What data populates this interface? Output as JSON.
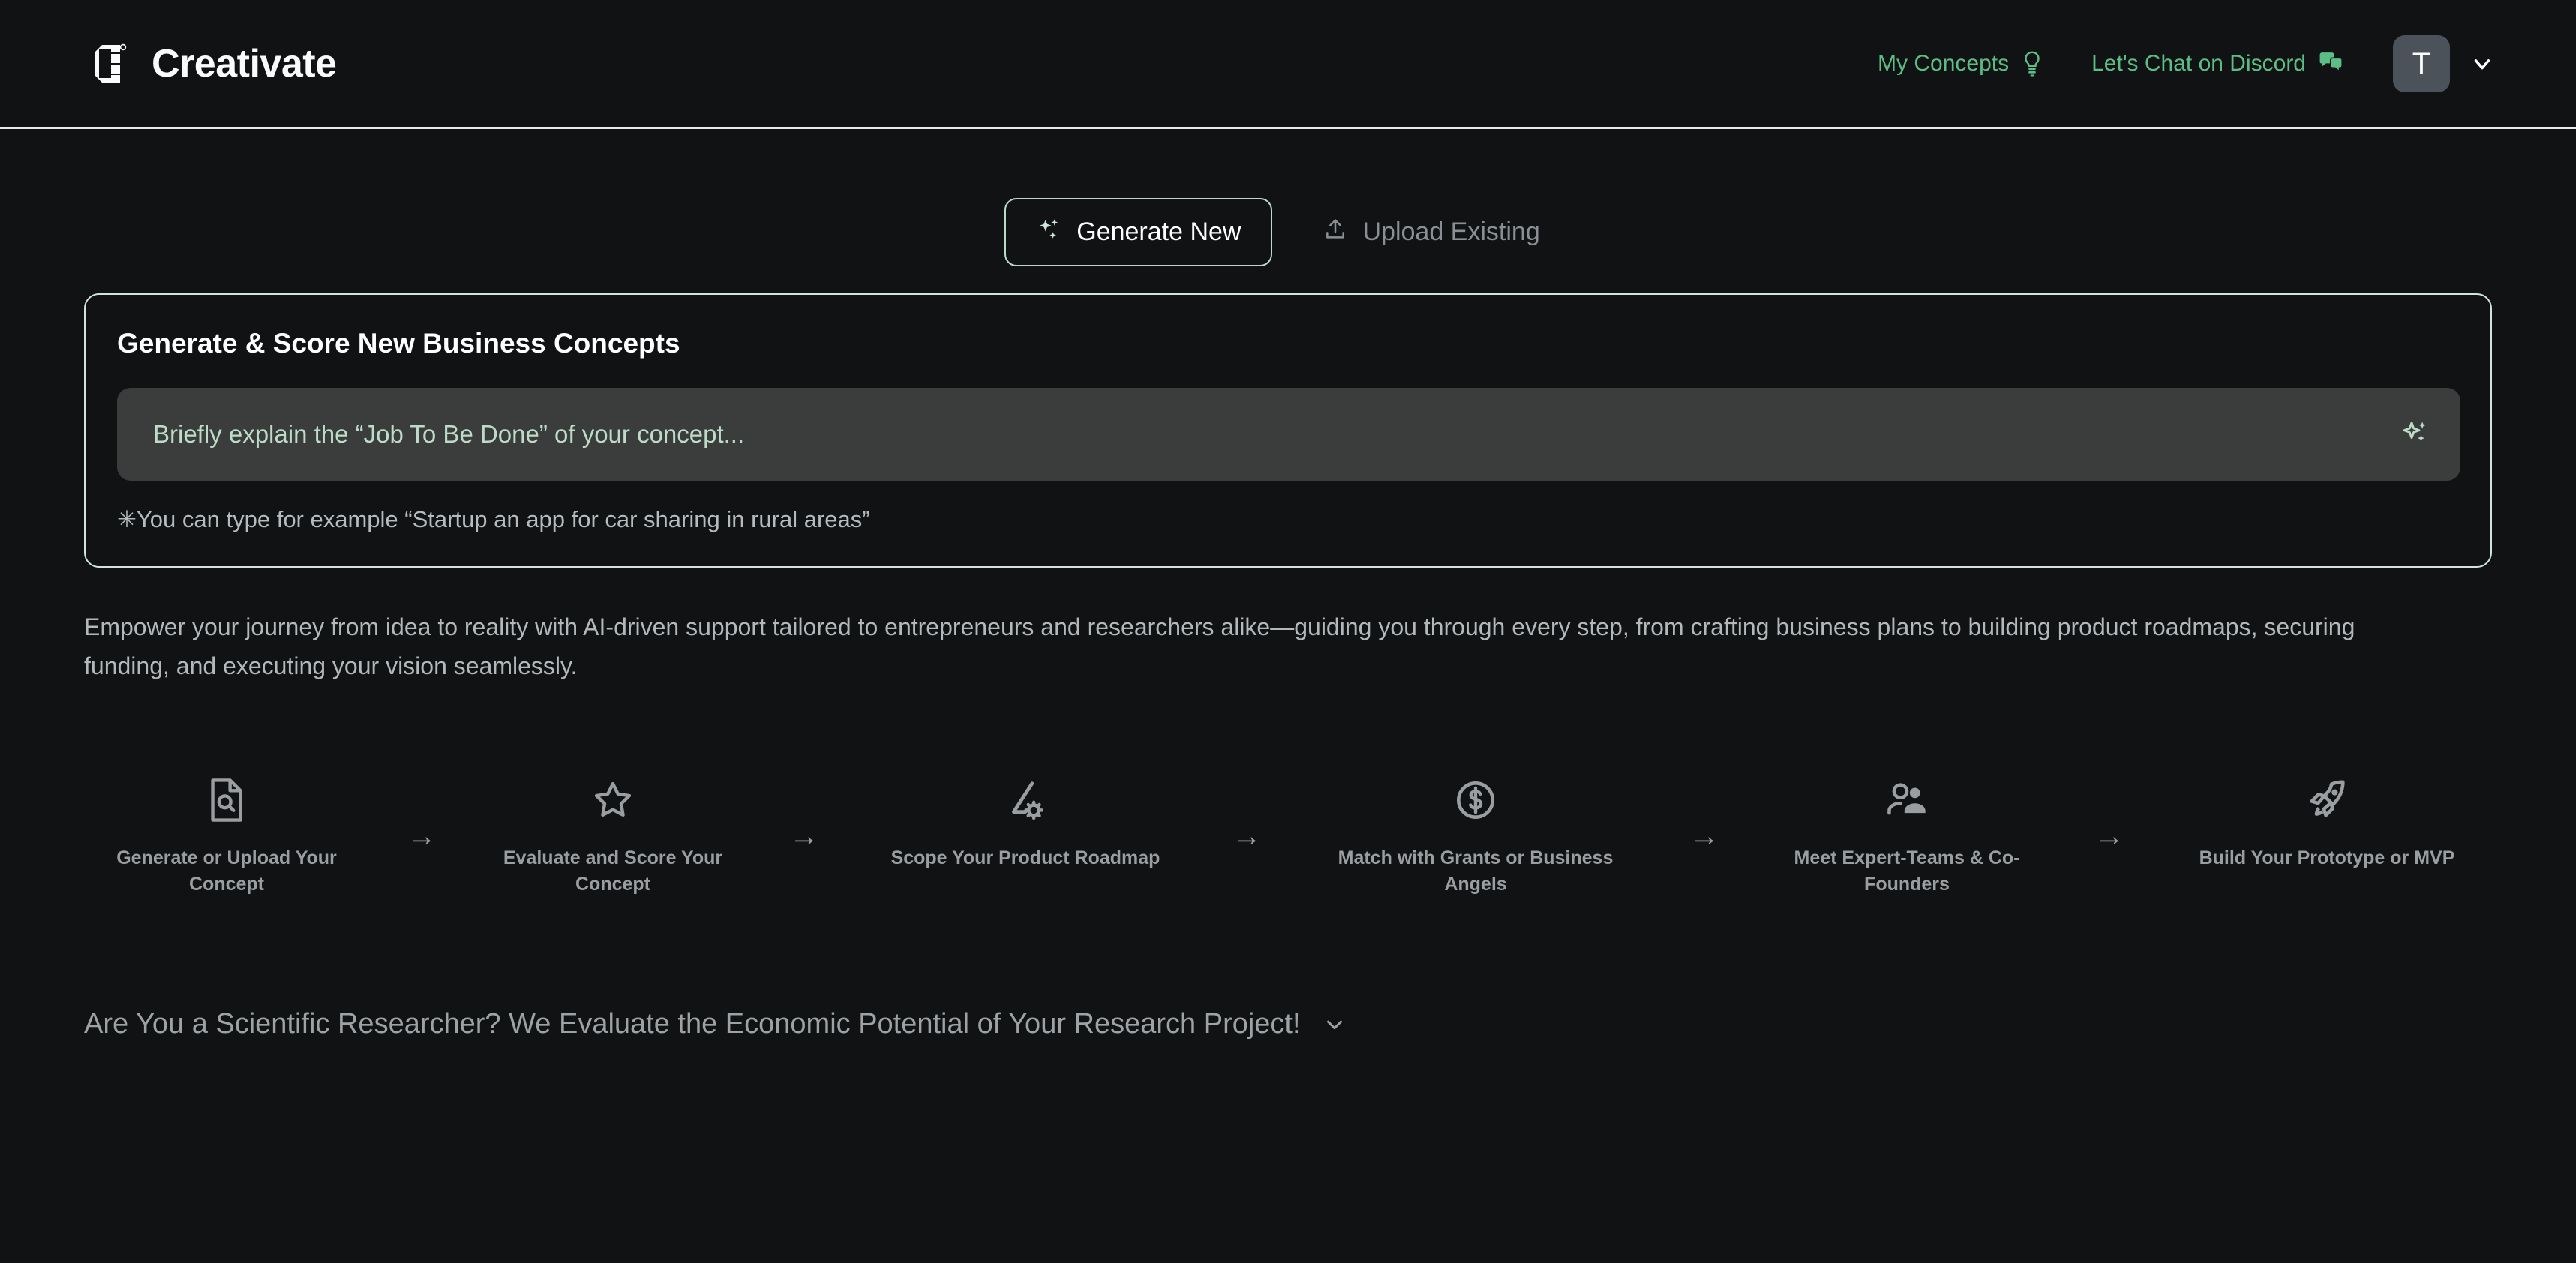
{
  "header": {
    "brand_name": "Creativate",
    "logo_icon": "creativate-logo-mark",
    "nav": [
      {
        "label": "My Concepts",
        "icon": "lightbulb-icon"
      },
      {
        "label": "Let's Chat on Discord",
        "icon": "chat-bubbles-icon"
      }
    ],
    "avatar_initial": "T",
    "avatar_chevron_icon": "chevron-down-icon"
  },
  "tabs": [
    {
      "label": "Generate New",
      "icon": "sparkles-icon",
      "active": true
    },
    {
      "label": "Upload Existing",
      "icon": "upload-icon",
      "active": false
    }
  ],
  "card": {
    "title": "Generate & Score New Business Concepts",
    "input_value": "",
    "input_placeholder": "Briefly explain the “Job To Be Done” of your concept...",
    "input_icon": "sparkles-icon",
    "hint": "✳You can type for example “Startup an app for car sharing in rural areas”"
  },
  "description": "Empower your journey from idea to reality with AI-driven support tailored to entrepreneurs and researchers alike—guiding you through every step, from crafting business plans to building product roadmaps, securing funding, and executing your vision seamlessly.",
  "steps": [
    {
      "label": "Generate or Upload Your Concept",
      "icon": "document-search-icon"
    },
    {
      "label": "Evaluate and Score Your Concept",
      "icon": "star-outline-icon"
    },
    {
      "label": "Scope Your Product Roadmap",
      "icon": "ruler-gear-icon"
    },
    {
      "label": "Match with Grants or Business Angels",
      "icon": "dollar-circle-icon"
    },
    {
      "label": "Meet Expert-Teams & Co-Founders",
      "icon": "users-icon"
    },
    {
      "label": "Build Your Prototype or MVP",
      "icon": "rocket-icon"
    }
  ],
  "step_arrow": "→",
  "accordion": {
    "title": "Are You a Scientific Researcher? We Evaluate the Economic Potential of Your Research Project!",
    "chevron_icon": "chevron-down-icon"
  },
  "colors": {
    "background": "#101214",
    "accent_green": "#5dbd86",
    "mint": "#bcdcc9",
    "card_border": "#cfe5da",
    "input_bg": "#3b3c3c",
    "muted_text": "#9a9ea1"
  }
}
